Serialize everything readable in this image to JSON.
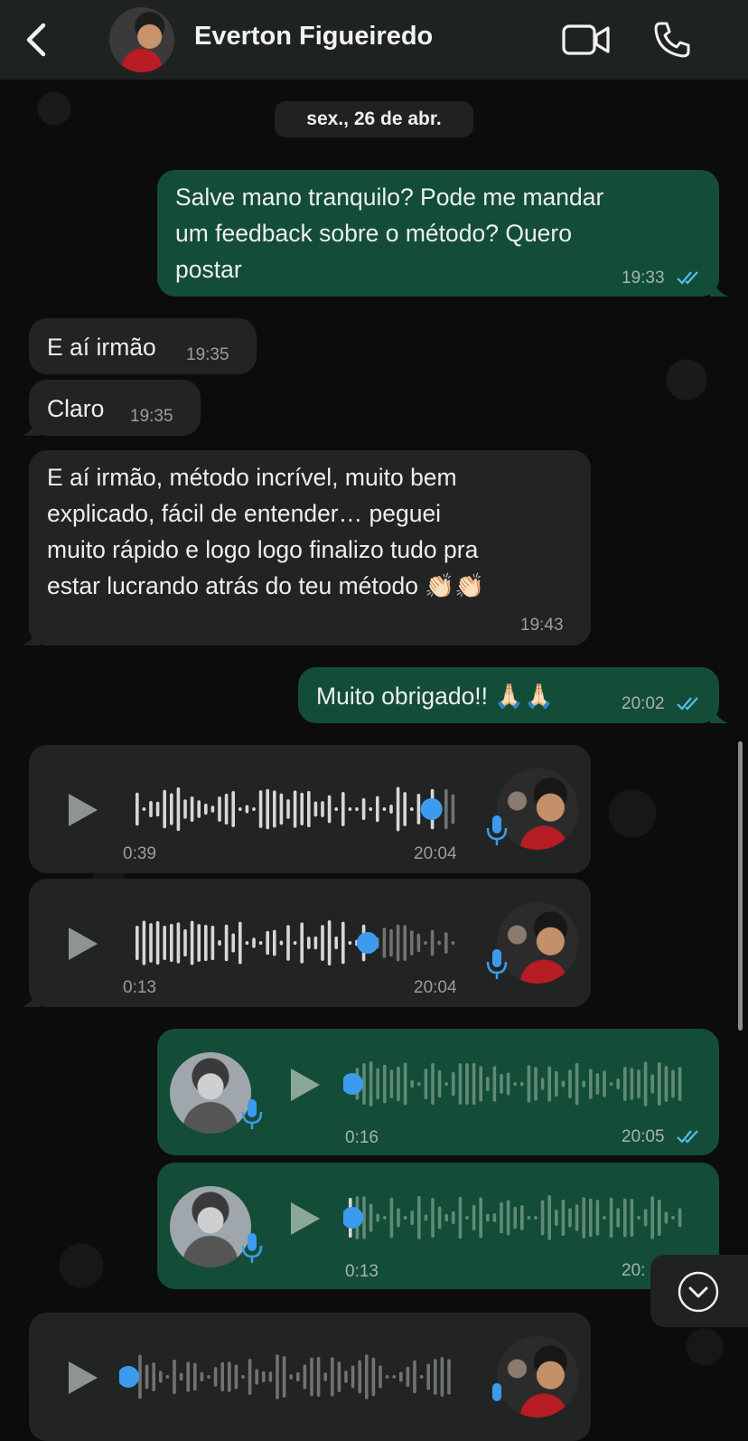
{
  "header": {
    "contact_name": "Everton Figueiredo",
    "icons": [
      "back-chevron-icon",
      "contact-avatar",
      "video-call-icon",
      "phone-call-icon"
    ]
  },
  "date_separator": "sex., 26 de abr.",
  "messages": [
    {
      "direction": "out",
      "type": "text",
      "lines": [
        "Salve mano tranquilo? Pode me mandar",
        "um feedback sobre o método? Quero",
        "postar"
      ],
      "time": "19:33",
      "read": true
    },
    {
      "direction": "in",
      "type": "text",
      "lines": [
        "E aí irmão"
      ],
      "time": "19:35"
    },
    {
      "direction": "in",
      "type": "text",
      "lines": [
        "Claro"
      ],
      "time": "19:35"
    },
    {
      "direction": "in",
      "type": "text",
      "lines": [
        "E aí irmão, método incrível, muito bem",
        "explicado, fácil de entender… peguei",
        "muito rápido e logo logo finalizo tudo pra",
        "estar lucrando atrás do teu método 👏🏻👏🏻"
      ],
      "time": "19:43"
    },
    {
      "direction": "out",
      "type": "text",
      "lines": [
        "Muito obrigado!! 🙏🏻🙏🏻"
      ],
      "time": "20:02",
      "read": true
    },
    {
      "direction": "in",
      "type": "audio",
      "duration": "0:39",
      "time": "20:04",
      "progress": 0.92
    },
    {
      "direction": "in",
      "type": "audio",
      "duration": "0:13",
      "time": "20:04",
      "progress": 0.72
    },
    {
      "direction": "out",
      "type": "audio",
      "duration": "0:16",
      "time": "20:05",
      "progress": 0.0,
      "read": true
    },
    {
      "direction": "out",
      "type": "audio",
      "duration": "0:13",
      "time": "20:",
      "progress": 0.0
    },
    {
      "direction": "in",
      "type": "audio",
      "duration": "",
      "time": "",
      "progress": 0.0
    }
  ],
  "colors": {
    "outgoing_bubble": "#144d37",
    "incoming_bubble": "#222424",
    "read_ticks": "#53bdeb",
    "play_dot": "#3d9bef"
  }
}
